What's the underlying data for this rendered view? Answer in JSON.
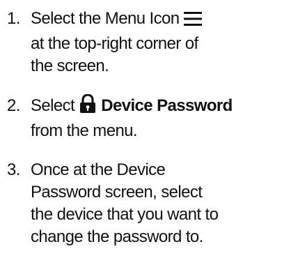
{
  "steps": [
    {
      "number": "1.",
      "line1_text": "Select the Menu Icon",
      "line1_icon": "menu-icon",
      "line2": "at the top-right corner of",
      "line3": "the screen."
    },
    {
      "number": "2.",
      "line1_prefix": "Select",
      "line1_icon": "lock-icon",
      "line1_bold": "Device Password",
      "line2": "from the menu."
    },
    {
      "number": "3.",
      "line1": "Once at the Device",
      "line2": "Password screen, select",
      "line3": "the device that you want to",
      "line4": "change the password to."
    }
  ],
  "colors": {
    "text": "#111111",
    "background": "#ffffff"
  }
}
